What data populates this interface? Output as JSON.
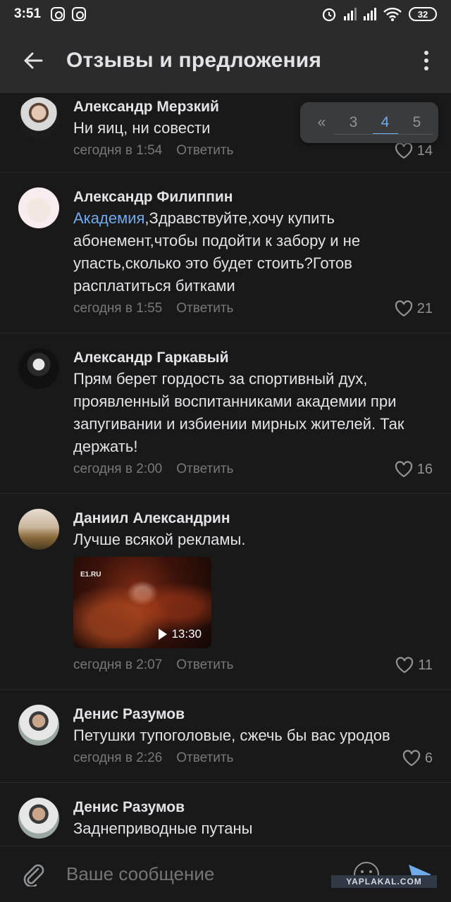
{
  "status_bar": {
    "time": "3:51",
    "battery": "32"
  },
  "header": {
    "title": "Отзывы и предложения"
  },
  "pagination": {
    "prev": "«",
    "pages": [
      "3",
      "4",
      "5"
    ],
    "active": "4"
  },
  "comments": [
    {
      "author": "Александр Мерзкий",
      "text": "Ни яиц, ни совести",
      "time": "сегодня в 1:54",
      "reply": "Ответить",
      "likes": "14"
    },
    {
      "author": "Александр Филиппин",
      "mention": "Академия",
      "text": ",Здравствуйте,хочу купить абонемент,чтобы подойти к забору и не упасть,сколько это будет стоить?Готов расплатиться битками",
      "time": "сегодня в 1:55",
      "reply": "Ответить",
      "likes": "21"
    },
    {
      "author": "Александр Гаркавый",
      "text": "Прям берет гордость за спортивный дух, проявленный воспитанниками академии при запугивании и избиении мирных жителей. Так держать!",
      "time": "сегодня в 2:00",
      "reply": "Ответить",
      "likes": "16"
    },
    {
      "author": "Даниил Александрин",
      "text": "Лучше всякой рекламы.",
      "video": {
        "logo": "E1.RU",
        "duration": "13:30"
      },
      "time": "сегодня в 2:07",
      "reply": "Ответить",
      "likes": "11"
    },
    {
      "author": "Денис Разумов",
      "text": "Петушки тупоголовые, сжечь бы вас уродов",
      "time": "сегодня в 2:26",
      "reply": "Ответить",
      "likes": "6"
    },
    {
      "author": "Денис Разумов",
      "text": "Заднеприводные путаны"
    }
  ],
  "composer": {
    "placeholder": "Ваше сообщение"
  },
  "watermark": "YAPLAKAL.COM",
  "colors": {
    "background": "#19191a",
    "header": "#2b2b2c",
    "accent": "#71aaeb",
    "meta": "#76787a"
  }
}
